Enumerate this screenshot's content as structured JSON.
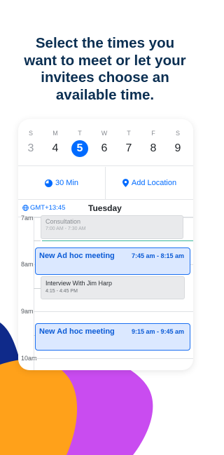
{
  "headline": {
    "lines": [
      "Select the times you",
      "want to meet or let your",
      "invitees choose an",
      "available time."
    ]
  },
  "colors": {
    "brand_blue": "#006bff",
    "headline": "#0b2f52",
    "blob_navy": "#0f2a8a",
    "blob_orange": "#ffa11a",
    "blob_purple": "#c94cf0"
  },
  "week": [
    {
      "dow": "S",
      "num": "3",
      "state": "past"
    },
    {
      "dow": "M",
      "num": "4",
      "state": "normal"
    },
    {
      "dow": "T",
      "num": "5",
      "state": "selected"
    },
    {
      "dow": "W",
      "num": "6",
      "state": "normal"
    },
    {
      "dow": "T",
      "num": "7",
      "state": "normal"
    },
    {
      "dow": "F",
      "num": "8",
      "state": "normal"
    },
    {
      "dow": "S",
      "num": "9",
      "state": "normal"
    }
  ],
  "options": {
    "duration": {
      "label": "30 Min",
      "icon": "clock-pie-icon"
    },
    "location": {
      "label": "Add Location",
      "icon": "location-pin-icon"
    }
  },
  "timezone": {
    "label": "GMT+13:45",
    "icon": "globe-icon"
  },
  "day_title": "Tuesday",
  "hours": {
    "h7": "7am",
    "h8": "8am",
    "h9": "9am",
    "h10": "10am"
  },
  "events": {
    "consultation": {
      "title": "Consultation",
      "time": "7:00 AM - 7:30 AM"
    },
    "adhoc1": {
      "title": "New Ad hoc meeting",
      "time": "7:45 am - 8:15 am"
    },
    "interview": {
      "title": "Interview With Jim Harp",
      "time": "4:15 - 4:45 PM"
    },
    "adhoc2": {
      "title": "New Ad hoc meeting",
      "time": "9:15 am - 9:45 am"
    }
  }
}
